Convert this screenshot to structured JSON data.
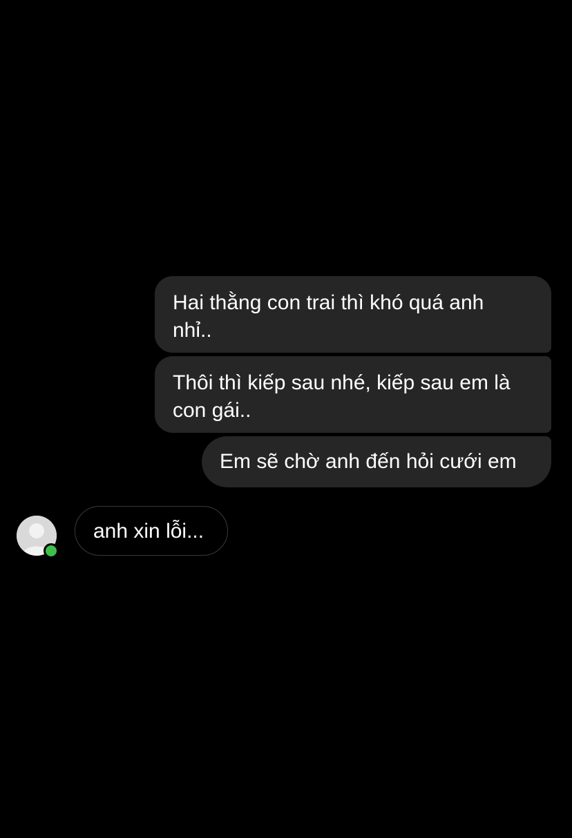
{
  "conversation": {
    "sent_messages": [
      {
        "text": "Hai thằng con trai thì khó quá anh\nnhỉ.."
      },
      {
        "text": "Thôi thì kiếp sau nhé, kiếp sau em là\ncon gái.."
      },
      {
        "text": "Em sẽ chờ anh đến hỏi cưới em"
      }
    ],
    "received_messages": [
      {
        "text": "anh xin lỗi..."
      }
    ],
    "contact": {
      "avatar_icon": "default-user-avatar-icon",
      "status": "online",
      "status_color": "#3fbf4a"
    }
  },
  "theme": {
    "background": "#000000",
    "sent_bubble_color": "#262626",
    "received_bubble_border": "#3a3a3a",
    "text_color": "#ffffff"
  }
}
